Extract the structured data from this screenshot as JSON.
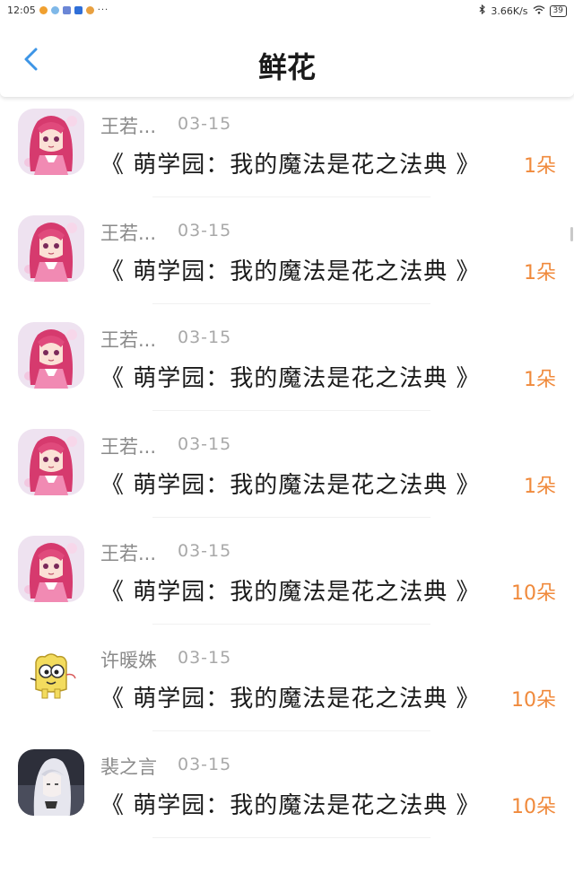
{
  "status_bar": {
    "time": "12:05",
    "more": "···",
    "network_speed": "3.66K/s",
    "battery": "39"
  },
  "header": {
    "back_label": "<",
    "title": "鲜花"
  },
  "colors": {
    "accent_back": "#3d95e6",
    "count_orange": "#f08a3c",
    "name_gray": "#8a8a8a",
    "date_gray": "#a8a8a8"
  },
  "rows": [
    {
      "name": "",
      "date": "",
      "title": "《 萌学园：我的魔法是花之法典 》",
      "count": "1朵",
      "avatar": "pink-haired-anime-girl"
    },
    {
      "name": "王若...",
      "date": "03-15",
      "title": "《 萌学园：我的魔法是花之法典 》",
      "count": "1朵",
      "avatar": "pink-haired-anime-girl"
    },
    {
      "name": "王若...",
      "date": "03-15",
      "title": "《 萌学园：我的魔法是花之法典 》",
      "count": "1朵",
      "avatar": "pink-haired-anime-girl"
    },
    {
      "name": "王若...",
      "date": "03-15",
      "title": "《 萌学园：我的魔法是花之法典 》",
      "count": "1朵",
      "avatar": "pink-haired-anime-girl"
    },
    {
      "name": "王若...",
      "date": "03-15",
      "title": "《 萌学园：我的魔法是花之法典 》",
      "count": "1朵",
      "avatar": "pink-haired-anime-girl"
    },
    {
      "name": "王若...",
      "date": "03-15",
      "title": "《 萌学园：我的魔法是花之法典 》",
      "count": "10朵",
      "avatar": "pink-haired-anime-girl"
    },
    {
      "name": "许暖姝",
      "date": "03-15",
      "title": "《 萌学园：我的魔法是花之法典 》",
      "count": "10朵",
      "avatar": "yellow-cartoon-bread"
    },
    {
      "name": "裴之言",
      "date": "03-15",
      "title": "《 萌学园：我的魔法是花之法典 》",
      "count": "10朵",
      "avatar": "white-haired-anime-character"
    }
  ]
}
